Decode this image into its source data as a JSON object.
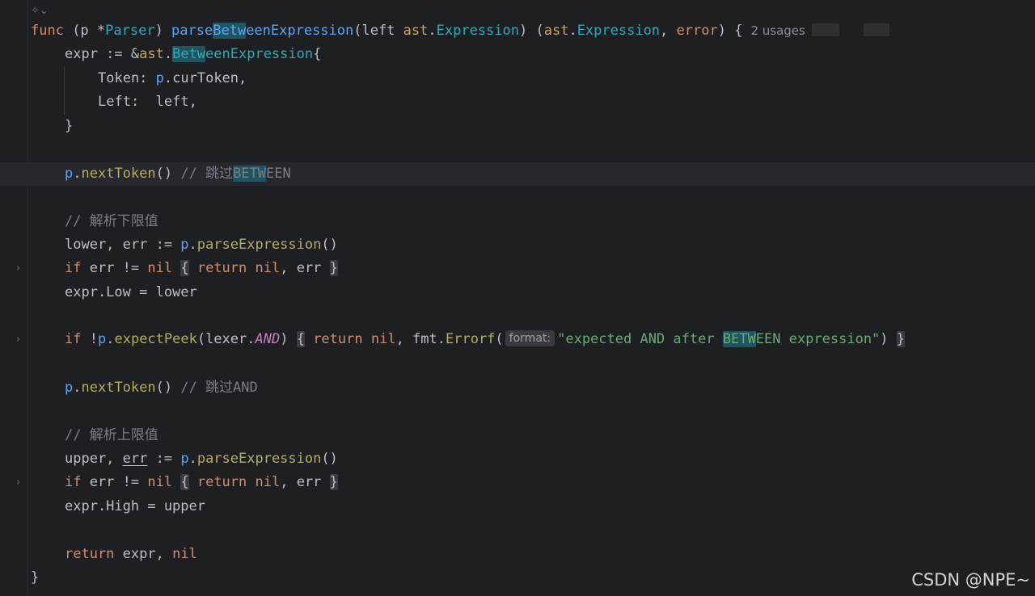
{
  "editor": {
    "usages_label": "2 usages",
    "inlay_format": "format:",
    "watermark": "CSDN @NPE~",
    "lines": {
      "l1": {
        "func": "func",
        "recv_open": " (p *",
        "recv_type": "Parser",
        "recv_close": ") ",
        "name_pre": "parse",
        "name_hl": "Betw",
        "name_post": "eenExpression",
        "param_open": "(left ",
        "pkg": "ast",
        "dot": ".",
        "param_type": "Expression",
        "params_close": ") (",
        "ret_pkg": "ast",
        "ret_type": "Expression",
        "comma": ", ",
        "err_type": "error",
        "end": ") {"
      },
      "l2": {
        "expr": "expr := &",
        "pkg": "ast",
        "dot": ".",
        "type_hl": "Betw",
        "type_rest": "eenExpression",
        "brace": "{"
      },
      "l3": {
        "field": "Token: ",
        "p": "p",
        "rest": ".curToken,"
      },
      "l4": {
        "text": "Left:  left,"
      },
      "l5": {
        "text": "}"
      },
      "l7": {
        "p": "p",
        "dot": ".",
        "method": "nextToken",
        "call": "()",
        "comment_pre": " // 跳过",
        "comment_hl": "BETW",
        "comment_post": "EEN"
      },
      "l9": {
        "comment": "// 解析下限值"
      },
      "l10": {
        "lhs": "lower, err := ",
        "p": "p",
        "dot": ".",
        "method": "parseExpression",
        "call": "()"
      },
      "l11": {
        "if": "if",
        "cond": " err != ",
        "nil": "nil",
        "sp": " ",
        "ob": "{",
        "sp2": " ",
        "ret": "return",
        "sp3": " ",
        "nil2": "nil",
        "rest": ", err ",
        "cb": "}"
      },
      "l12": {
        "text": "expr.Low = lower"
      },
      "l14": {
        "if": "if",
        "bang": " !",
        "p": "p",
        "dot": ".",
        "method": "expectPeek",
        "open": "(lexer.",
        "const": "AND",
        "close": ") ",
        "ob": "{",
        "sp": " ",
        "ret": "return",
        "sp2": " ",
        "nil": "nil",
        "comma": ", fmt.",
        "fn": "Errorf",
        "paren": "(",
        "str_pre": "\"expected AND after ",
        "str_hl": "BETW",
        "str_post": "EEN expression\"",
        "end": ")",
        "sp3": " ",
        "cb": "}"
      },
      "l16": {
        "p": "p",
        "dot": ".",
        "method": "nextToken",
        "call": "()",
        "comment": " // 跳过AND"
      },
      "l18": {
        "comment": "// 解析上限值"
      },
      "l19": {
        "lhs": "upper, ",
        "err": "err",
        "mid": " := ",
        "p": "p",
        "dot": ".",
        "method": "parseExpression",
        "call": "()"
      },
      "l20": {
        "if": "if",
        "cond": " err != ",
        "nil": "nil",
        "sp": " ",
        "ob": "{",
        "sp2": " ",
        "ret": "return",
        "sp3": " ",
        "nil2": "nil",
        "rest": ", err ",
        "cb": "}"
      },
      "l21": {
        "text": "expr.High = upper"
      },
      "l23": {
        "ret": "return",
        "mid": " expr, ",
        "nil": "nil"
      },
      "l24": {
        "text": "}"
      }
    }
  }
}
